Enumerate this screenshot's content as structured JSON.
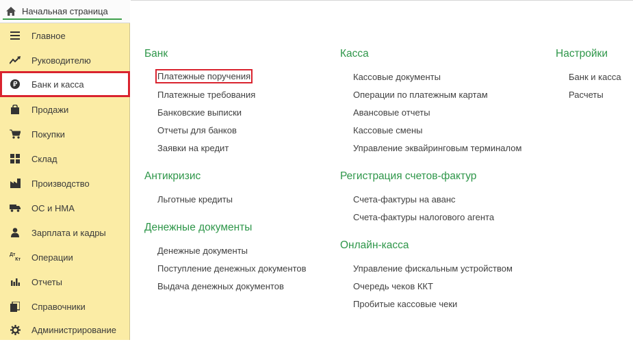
{
  "home_tab": {
    "label": "Начальная страница",
    "icon": "home-icon"
  },
  "sidebar": {
    "items": [
      {
        "label": "Главное",
        "icon": "menu-lines-icon"
      },
      {
        "label": "Руководителю",
        "icon": "trend-up-icon"
      },
      {
        "label": "Банк и касса",
        "icon": "ruble-coin-icon",
        "active": true
      },
      {
        "label": "Продажи",
        "icon": "shopping-bag-icon"
      },
      {
        "label": "Покупки",
        "icon": "cart-icon"
      },
      {
        "label": "Склад",
        "icon": "grid-warehouse-icon"
      },
      {
        "label": "Производство",
        "icon": "factory-icon"
      },
      {
        "label": "ОС и НМА",
        "icon": "truck-icon"
      },
      {
        "label": "Зарплата и кадры",
        "icon": "person-icon"
      },
      {
        "label": "Операции",
        "icon": "dt-kt-icon"
      },
      {
        "label": "Отчеты",
        "icon": "bar-chart-icon"
      },
      {
        "label": "Справочники",
        "icon": "books-icon"
      },
      {
        "label": "Администрирование",
        "icon": "gear-icon"
      }
    ],
    "dt_kt_glyph": {
      "top": "Дт",
      "bottom": "Кт"
    }
  },
  "sections": {
    "bank": {
      "title": "Банк",
      "links": [
        "Платежные поручения",
        "Платежные требования",
        "Банковские выписки",
        "Отчеты для банков",
        "Заявки на кредит"
      ]
    },
    "anticrisis": {
      "title": "Антикризис",
      "links": [
        "Льготные кредиты"
      ]
    },
    "money_docs": {
      "title": "Денежные документы",
      "links": [
        "Денежные документы",
        "Поступление денежных документов",
        "Выдача денежных документов"
      ]
    },
    "kassa": {
      "title": "Касса",
      "links": [
        "Кассовые документы",
        "Операции по платежным картам",
        "Авансовые отчеты",
        "Кассовые смены",
        "Управление эквайринговым терминалом"
      ]
    },
    "invoices": {
      "title": "Регистрация счетов-фактур",
      "links": [
        "Счета-фактуры на аванс",
        "Счета-фактуры налогового агента"
      ]
    },
    "online_kassa": {
      "title": "Онлайн-касса",
      "links": [
        "Управление фискальным устройством",
        "Очередь чеков ККТ",
        "Пробитые кассовые чеки"
      ]
    },
    "settings": {
      "title": "Настройки",
      "links": [
        "Банк и касса",
        "Расчеты"
      ]
    }
  },
  "colors": {
    "sidebar_bg": "#fbeca5",
    "section_title": "#2e9649",
    "highlight_border": "#d9232e",
    "tab_underline": "#3d9f4a"
  }
}
